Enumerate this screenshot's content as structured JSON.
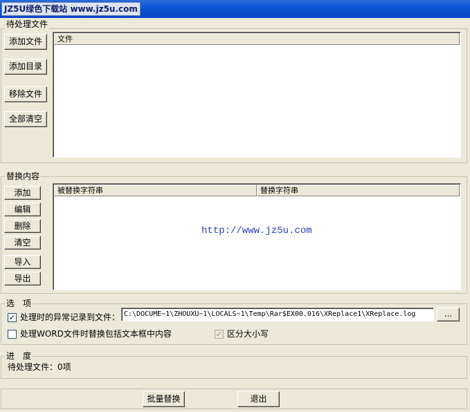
{
  "window": {
    "watermark": "JZ5U绿色下载站 www.jz5u.com"
  },
  "files_group": {
    "legend": "待处理文件",
    "buttons": {
      "add_file": "添加文件",
      "add_dir": "添加目录",
      "remove_file": "移除文件",
      "clear_all": "全部清空"
    },
    "columns": [
      "文件"
    ]
  },
  "replace_group": {
    "legend": "替换内容",
    "buttons": {
      "add": "添加",
      "edit": "编辑",
      "delete": "删除",
      "clear": "清空",
      "import": "导入",
      "export": "导出"
    },
    "columns": [
      "被替换字符串",
      "替换字符串"
    ],
    "watermark_url": "http://www.jz5u.com"
  },
  "options_group": {
    "legend": "选　项",
    "log_errors_label": "处理时的异常记录到文件：",
    "log_errors_checked": true,
    "log_path": "C:\\DOCUME~1\\ZHOUXU~1\\LOCALS~1\\Temp\\Rar$EX00.016\\XReplace1\\XReplace.log",
    "browse_label": "...",
    "word_textbox_label": "处理WORD文件时替换包括文本框中内容",
    "word_textbox_checked": false,
    "case_sensitive_label": "区分大小写",
    "case_sensitive_checked": true
  },
  "progress_group": {
    "legend": "进　度",
    "status": "待处理文件：0项"
  },
  "footer": {
    "batch_replace": "批量替换",
    "exit": "退出"
  }
}
